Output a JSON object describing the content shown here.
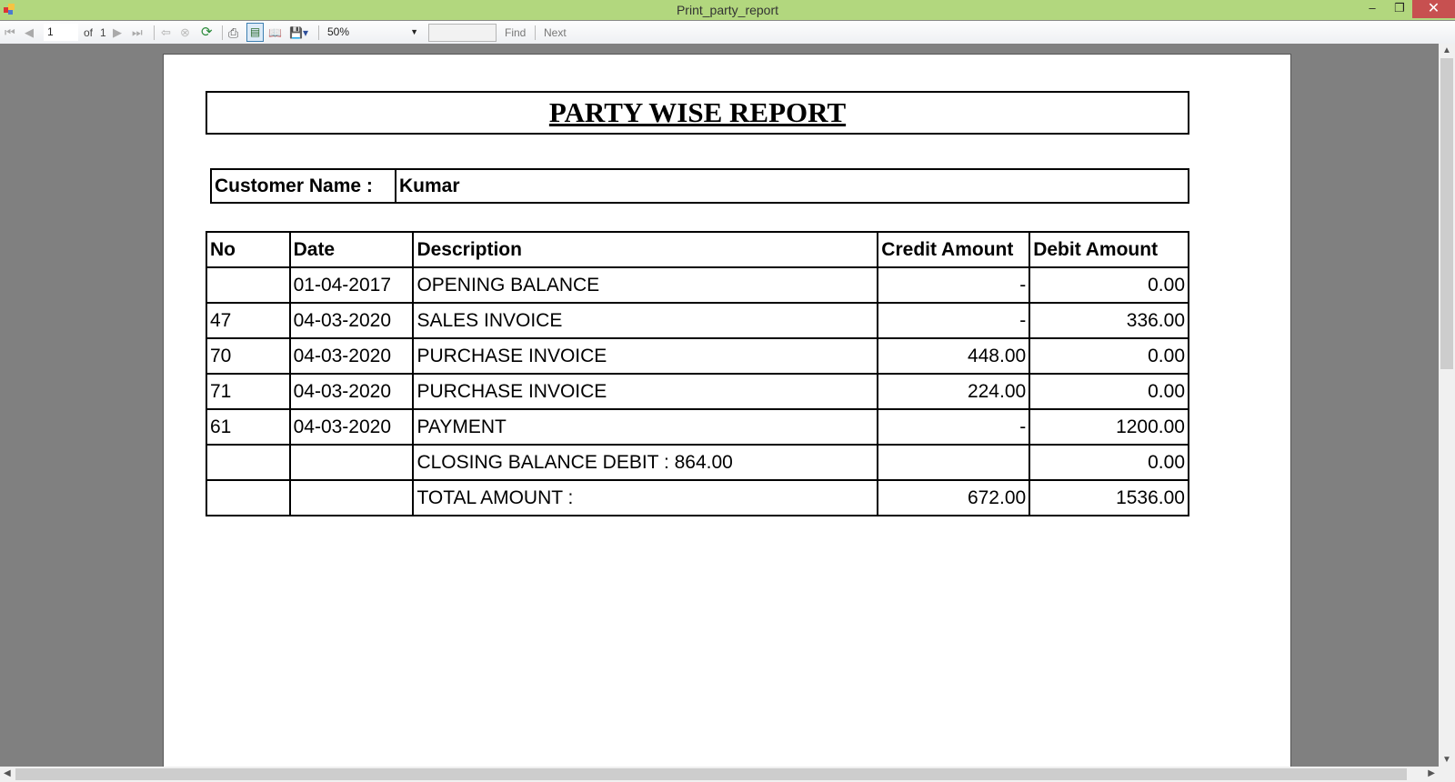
{
  "window": {
    "title": "Print_party_report",
    "minimize": "–",
    "restore": "❐",
    "close": "✕"
  },
  "toolbar": {
    "page_current": "1",
    "page_of": "of",
    "page_total": "1",
    "zoom": "50%",
    "find_value": "",
    "find_label": "Find",
    "next_label": "Next",
    "icons": [
      "first-page-icon",
      "prev-page-icon",
      "next-page-icon",
      "last-page-icon",
      "back-icon",
      "stop-icon",
      "refresh-icon",
      "print-icon",
      "print-layout-icon",
      "page-setup-icon",
      "export-icon"
    ]
  },
  "report": {
    "title": "PARTY WISE REPORT",
    "customer_label": "Customer Name :",
    "customer_name": "Kumar",
    "columns": [
      "No",
      "Date",
      "Description",
      "Credit Amount",
      "Debit Amount"
    ],
    "rows": [
      [
        "",
        "01-04-2017",
        "OPENING BALANCE",
        "-",
        "0.00"
      ],
      [
        "47",
        "04-03-2020",
        "SALES INVOICE",
        "-",
        "336.00"
      ],
      [
        "70",
        "04-03-2020",
        "PURCHASE INVOICE",
        "448.00",
        "0.00"
      ],
      [
        "71",
        "04-03-2020",
        "PURCHASE INVOICE",
        "224.00",
        "0.00"
      ],
      [
        "61",
        "04-03-2020",
        "PAYMENT",
        "-",
        "1200.00"
      ],
      [
        "",
        "",
        "CLOSING BALANCE DEBIT : 864.00",
        "",
        "0.00"
      ],
      [
        "",
        "",
        "TOTAL AMOUNT :",
        "672.00",
        "1536.00"
      ]
    ]
  }
}
